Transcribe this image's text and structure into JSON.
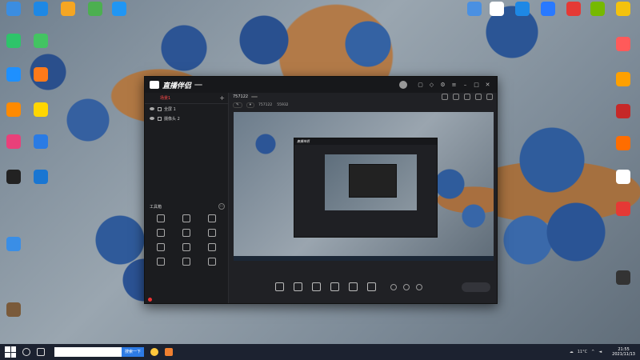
{
  "desktop": {
    "left_icons": [
      {
        "label": "",
        "color": "#3b8de0"
      },
      {
        "label": "",
        "color": "#1e88e5"
      },
      {
        "label": "",
        "color": "#f5a623"
      },
      {
        "label": "",
        "color": "#4caf50"
      },
      {
        "label": "",
        "color": "#2196f3"
      },
      {
        "label": "",
        "color": "#2ec46a"
      },
      {
        "label": "",
        "color": "#43c462"
      },
      {
        "label": "",
        "color": "#1e90ff"
      },
      {
        "label": "",
        "color": "#ff7a1a"
      },
      {
        "label": "",
        "color": "#ff8a00"
      },
      {
        "label": "",
        "color": "#ffd600"
      },
      {
        "label": "",
        "color": "#e9407a"
      },
      {
        "label": "",
        "color": "#2a7be4"
      },
      {
        "label": "",
        "color": "#222222"
      },
      {
        "label": "",
        "color": "#1976d2"
      },
      {
        "label": "",
        "color": "#3a8ee6"
      },
      {
        "label": "",
        "color": "#7a5a3a"
      }
    ],
    "right_icons": [
      {
        "label": "",
        "color": "#4a90e2"
      },
      {
        "label": "",
        "color": "#ffffff"
      },
      {
        "label": "",
        "color": "#1e88e5"
      },
      {
        "label": "",
        "color": "#2979ff"
      },
      {
        "label": "",
        "color": "#e53935"
      },
      {
        "label": "",
        "color": "#76b900"
      },
      {
        "label": "",
        "color": "#f4c20d"
      },
      {
        "label": "",
        "color": "#ff5a5a"
      },
      {
        "label": "",
        "color": "#ffa000"
      },
      {
        "label": "",
        "color": "#c62828"
      },
      {
        "label": "",
        "color": "#ff6d00"
      },
      {
        "label": "",
        "color": "#ffffff"
      },
      {
        "label": "",
        "color": "#e53935"
      },
      {
        "label": "",
        "color": "#333333"
      }
    ]
  },
  "app": {
    "title": "直播伴侣",
    "badge": "",
    "tabs": [
      "",
      "",
      "",
      "场景1"
    ],
    "scenes": [
      {
        "label": "全屏 1"
      },
      {
        "label": "摄像头 2"
      }
    ],
    "toolbox_label": "工具箱",
    "toolbox_more": "⋯",
    "tools": [
      "",
      "",
      "",
      "",
      "",
      "",
      "",
      "",
      "",
      "",
      "",
      ""
    ],
    "notice": "",
    "room": {
      "title": "757122",
      "tag": "",
      "id_label": "757122",
      "fans": "55932"
    },
    "controls": [
      "",
      "",
      "",
      "",
      "",
      ""
    ],
    "start_button": "",
    "stats": [
      "",
      "",
      "",
      "",
      "",
      "",
      ""
    ],
    "preview_mini_title": "直播伴侣",
    "accent": "#ff4a4a"
  },
  "taskbar": {
    "search_placeholder": "",
    "search_button": "搜索一下",
    "weather": "11°C",
    "time": "21:55",
    "date": "2021/11/13"
  }
}
